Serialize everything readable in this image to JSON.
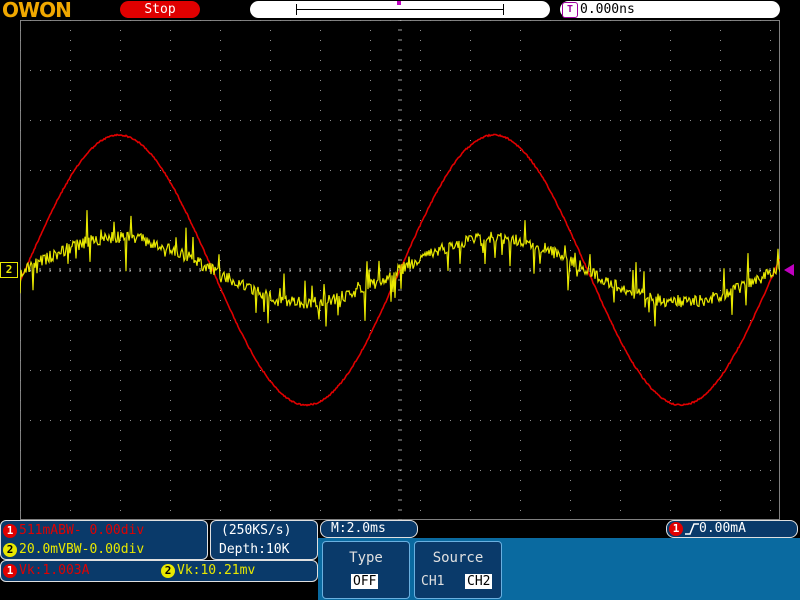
{
  "brand": "OWON",
  "run_state": "Stop",
  "trigger_time": "0.000ns",
  "trigger_badge": "T",
  "ch2_marker": "2",
  "channels": {
    "ch1_num": "1",
    "ch2_num": "2",
    "ch1_scale": "511mABW- 0.00div",
    "ch2_scale": "20.0mVBW-0.00div",
    "ch1_vk": "Vk:1.003A",
    "ch2_vk": "Vk:10.21mv"
  },
  "acquisition": {
    "sample_rate": "(250KS/s)",
    "depth": "Depth:10K",
    "timebase": "M:2.0ms"
  },
  "trigger_status": {
    "channel": "1",
    "level": "0.00mA"
  },
  "menu": {
    "type_label": "Type",
    "type_value": "OFF",
    "source_label": "Source",
    "source_options": [
      "CH1",
      "CH2"
    ],
    "source_selected": "CH2"
  },
  "colors": {
    "ch1": "#e00000",
    "ch2": "#e8e800",
    "grid": "#909090",
    "trigger": "#c000c0"
  },
  "chart_data": {
    "type": "line",
    "series": [
      {
        "channel": "CH1",
        "color": "#e00000",
        "shape": "sine",
        "amplitude_div": 2.7,
        "period_div": 7.5,
        "phase": "peak at left edge",
        "noise": "low"
      },
      {
        "channel": "CH2",
        "color": "#e8e800",
        "shape": "sine",
        "amplitude_div": 0.65,
        "period_div": 7.5,
        "phase": "in phase with CH1 (zero crossing at center)",
        "noise": "high"
      }
    ],
    "grid": {
      "x_divisions": 10,
      "y_divisions": 10
    },
    "xlabel": "",
    "ylabel": ""
  }
}
